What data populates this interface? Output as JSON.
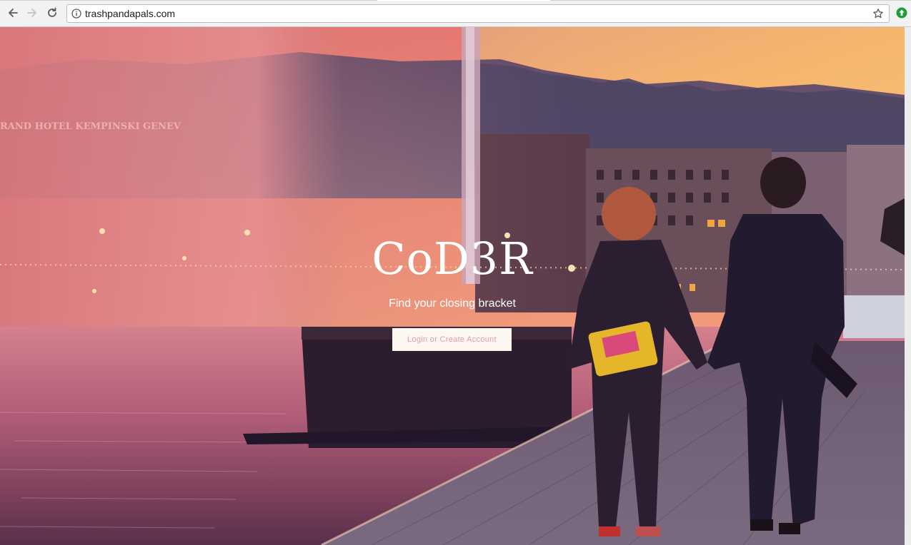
{
  "browser": {
    "url": "trashpandapals.com",
    "back_icon": "back-arrow-icon",
    "forward_icon": "forward-arrow-icon",
    "reload_icon": "reload-icon",
    "info_icon": "info-icon",
    "bookmark_icon": "star-icon",
    "extension_icon": "extension-icon",
    "extension_color": "#1e9e3a"
  },
  "hero": {
    "background_description_icon": "photo-background",
    "sign_text": "RAND HOTEL KEMPINSKI GENEV",
    "brand": "CoD3R",
    "tagline": "Find your closing bracket",
    "login_button": "Login or Create Account",
    "accent": "#e39aa0"
  }
}
